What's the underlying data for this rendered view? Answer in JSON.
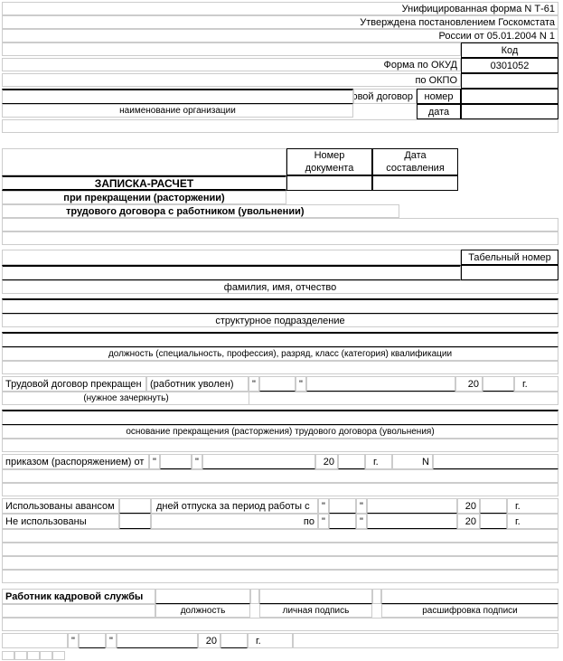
{
  "header": {
    "line1": "Унифицированная форма N Т-61",
    "line2": "Утверждена постановлением Госкомстата",
    "line3": "России от 05.01.2004 N 1",
    "code_label": "Код",
    "okud_label": "Форма по ОКУД",
    "okud_value": "0301052",
    "okpo_label": "по ОКПО",
    "org_label": "наименование организации",
    "contract_label": "Трудовой договор",
    "number_label": "номер",
    "date_label": "дата"
  },
  "doc_box": {
    "num_label": "Номер\nдокумента",
    "num_l1": "Номер",
    "num_l2": "документа",
    "date_l1": "Дата",
    "date_l2": "составления"
  },
  "title": {
    "line1": "ЗАПИСКА-РАСЧЕТ",
    "line2": "при прекращении (расторжении)",
    "line3": "трудового договора с работником (увольнении)"
  },
  "fields": {
    "tab_num": "Табельный номер",
    "fio": "фамилия, имя, отчество",
    "dept": "структурное подразделение",
    "position": "должность (специальность, профессия), разряд, класс (категория) квалификации",
    "terminated": "Трудовой договор прекращен",
    "fired": "(работник уволен)",
    "strike_note": "(нужное зачеркнуть)",
    "basis": "основание прекращения (расторжения) трудового договора (увольнения)",
    "by_order": "приказом (распоряжением) от",
    "n_label": "N",
    "used_advance": "Использованы авансом",
    "not_used": "Не использованы",
    "days_from": "дней отпуска за период работы с",
    "to": "по",
    "y20": "20",
    "yr": "г.",
    "q": "\"",
    "hr_officer": "Работник кадровой службы",
    "post": "должность",
    "sign": "личная подпись",
    "decode": "расшифровка подписи"
  }
}
